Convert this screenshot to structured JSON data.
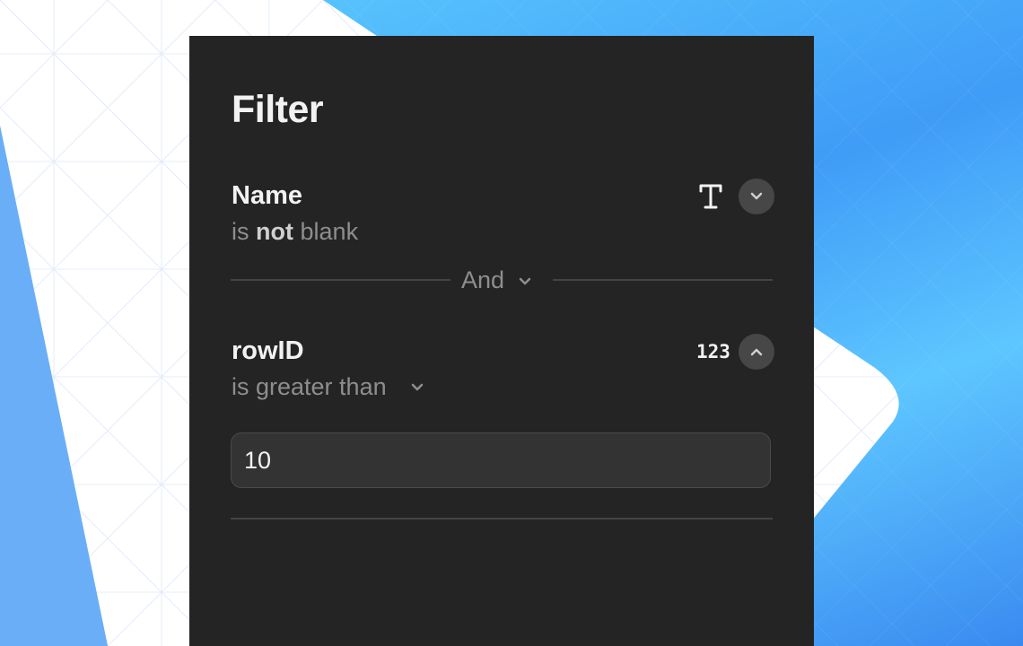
{
  "panel": {
    "title": "Filter",
    "filters": [
      {
        "field": "Name",
        "condition_prefix": "is",
        "condition_emphasis": "not",
        "condition_suffix": "blank",
        "type_icon": "text-type-icon",
        "toggle_icon": "chevron-down-icon"
      },
      {
        "field": "rowID",
        "condition": "is greater than",
        "type_icon_label": "123",
        "toggle_icon": "chevron-up-icon",
        "value": "10"
      }
    ],
    "conjunction": "And"
  }
}
